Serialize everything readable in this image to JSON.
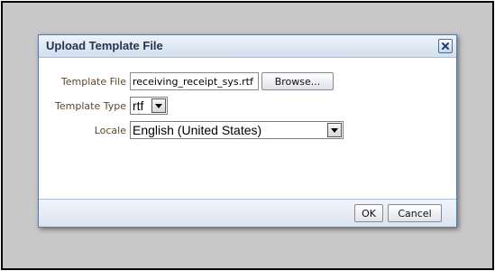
{
  "dialog": {
    "title": "Upload Template File"
  },
  "form": {
    "template_file": {
      "label": "Template File",
      "value": "receiving_receipt_sys.rtf",
      "browse_label": "Browse..."
    },
    "template_type": {
      "label": "Template Type",
      "value": "rtf"
    },
    "locale": {
      "label": "Locale",
      "value": "English (United States)"
    }
  },
  "buttons": {
    "ok_label": "OK",
    "cancel_label": "Cancel"
  },
  "icons": {
    "close": "close-icon",
    "dropdown": "chevron-down-icon"
  },
  "colors": {
    "frame_background": "#c8c8c8",
    "title_text": "#26344f",
    "label_text": "#5b4a2e",
    "title_bar": "#d3dfee"
  }
}
